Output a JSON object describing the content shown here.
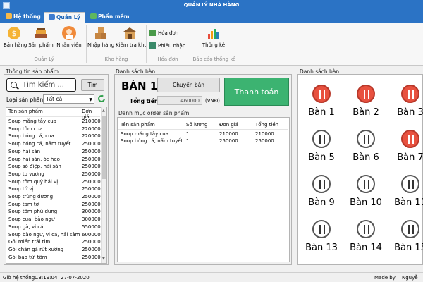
{
  "window": {
    "title": "QUẢN LÝ NHÀ HÀNG"
  },
  "tabs": [
    {
      "label": "Hệ thống",
      "icon": "gear-icon"
    },
    {
      "label": "Quản Lý",
      "icon": "manage-icon"
    },
    {
      "label": "Phần mềm",
      "icon": "software-icon"
    }
  ],
  "ribbon": {
    "quan_ly": {
      "group": "Quản Lý",
      "ban_hang": "Bán hàng",
      "san_pham": "Sản phẩm",
      "nhan_vien": "Nhân viên"
    },
    "kho_hang": {
      "group": "Kho hàng",
      "nhap_hang": "Nhập hàng",
      "kiem_tra_kho": "Kiểm tra kho"
    },
    "hoa_don": {
      "group": "Hóa đơn",
      "hoa_don": "Hóa đơn",
      "phieu_nhap": "Phiếu nhập"
    },
    "bao_cao": {
      "group": "Báo cáo thống kê",
      "thong_ke": "Thống kê"
    }
  },
  "product_panel": {
    "title": "Thông tin sản phẩm",
    "search_placeholder": "Tìm kiếm ...",
    "search_button": "Tìm",
    "category_label": "Loại sản phẩm:",
    "category_value": "Tất cả",
    "columns": {
      "name": "Tên sản phẩm",
      "price": "Đơn giá"
    },
    "items": [
      {
        "name": "Soup măng tây cua",
        "price": "210000"
      },
      {
        "name": "Soup tôm cua",
        "price": "220000"
      },
      {
        "name": "Soup bóng cá, cua",
        "price": "220000"
      },
      {
        "name": "Soup bóng cá, nấm tuyết",
        "price": "250000"
      },
      {
        "name": "Soup hải sản",
        "price": "250000"
      },
      {
        "name": "Soup hải sản, óc heo",
        "price": "250000"
      },
      {
        "name": "Soup sò điệp, hải sản",
        "price": "250000"
      },
      {
        "name": "Soup tơ vương",
        "price": "250000"
      },
      {
        "name": "Soup tôm quỷ hải vị",
        "price": "250000"
      },
      {
        "name": "Soup tứ vị",
        "price": "250000"
      },
      {
        "name": "Soup trùng dương",
        "price": "250000"
      },
      {
        "name": "Soup tam tơ",
        "price": "250000"
      },
      {
        "name": "Soup tôm phù dung",
        "price": "300000"
      },
      {
        "name": "Soup cua, bào ngư",
        "price": "300000"
      },
      {
        "name": "Soup gà, vi cá",
        "price": "550000"
      },
      {
        "name": "Soup bào ngư, vi cá, hải sâm",
        "price": "600000"
      },
      {
        "name": "Gỏi miền trái tim",
        "price": "250000"
      },
      {
        "name": "Gỏi chân gà rút xương",
        "price": "250000"
      },
      {
        "name": "Gỏi bao tử, tôm",
        "price": "250000"
      }
    ]
  },
  "order_panel": {
    "title": "Danh sách bàn",
    "table_name": "BÀN 1",
    "move_button": "Chuyển bàn",
    "total_label": "Tổng tiền:",
    "total_value": "460000",
    "currency": "(VNĐ)",
    "pay_button": "Thanh toán",
    "order_list_title": "Danh mục order sản phẩm",
    "columns": {
      "name": "Tên sản phẩm",
      "qty": "Số lượng",
      "price": "Đơn giá",
      "total": "Tổng tiền"
    },
    "rows": [
      {
        "name": "Soup măng tây cua",
        "qty": "1",
        "price": "210000",
        "total": "210000"
      },
      {
        "name": "Soup bóng cá, nấm tuyết",
        "qty": "1",
        "price": "250000",
        "total": "250000"
      }
    ]
  },
  "tables_panel": {
    "title": "Danh sách bàn",
    "tables": [
      {
        "label": "Bàn 1",
        "status": "busy"
      },
      {
        "label": "Bàn 2",
        "status": "busy"
      },
      {
        "label": "Bàn 3",
        "status": "busy"
      },
      {
        "label": "Bàn 5",
        "status": "free"
      },
      {
        "label": "Bàn 6",
        "status": "free"
      },
      {
        "label": "Bàn 7",
        "status": "busy"
      },
      {
        "label": "Bàn 9",
        "status": "free"
      },
      {
        "label": "Bàn 10",
        "status": "free"
      },
      {
        "label": "Bàn 11",
        "status": "free"
      },
      {
        "label": "Bàn 13",
        "status": "free"
      },
      {
        "label": "Bàn 14",
        "status": "free"
      },
      {
        "label": "Bàn 15",
        "status": "free"
      }
    ]
  },
  "status_bar": {
    "time_label": "Giờ hệ thống:",
    "time_value": "13:19:04",
    "date_value": "27-07-2020",
    "made_by_label": "Made by:",
    "made_by_value": "Nguyễ"
  },
  "colors": {
    "titlebar": "#2b73c5",
    "pay_button": "#3cb371",
    "table_busy": "#e8513f",
    "table_free": "#ffffff"
  }
}
